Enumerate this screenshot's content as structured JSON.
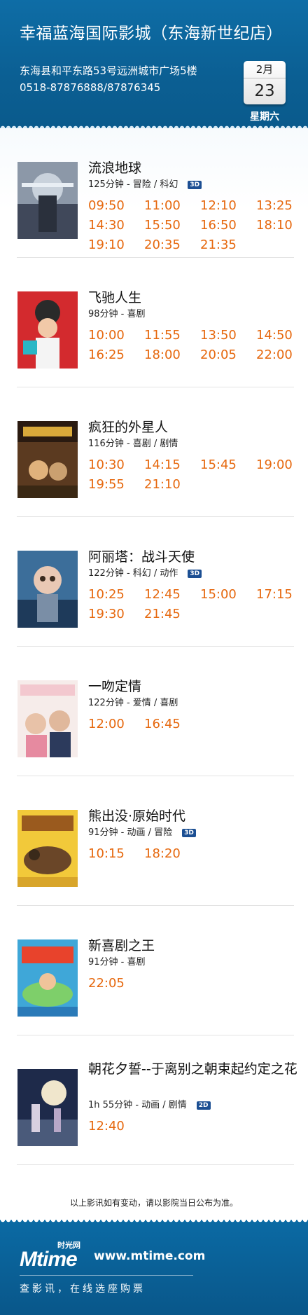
{
  "header": {
    "cinema_name": "幸福蓝海国际影城（东海新世纪店）",
    "address": "东海县和平东路53号远洲城市广场5楼",
    "phone": "0518-87876888/87876345",
    "date_month": "2月",
    "date_day": "23",
    "weekday": "星期六"
  },
  "movies": [
    {
      "title": "流浪地球",
      "info": "125分钟 - 冒险 / 科幻",
      "format": "3D",
      "times": [
        "09:50",
        "11:00",
        "12:10",
        "13:25",
        "14:30",
        "15:50",
        "16:50",
        "18:10",
        "19:10",
        "20:35",
        "21:35"
      ]
    },
    {
      "title": "飞驰人生",
      "info": "98分钟 - 喜剧",
      "format": "",
      "times": [
        "10:00",
        "11:55",
        "13:50",
        "14:50",
        "16:25",
        "18:00",
        "20:05",
        "22:00"
      ]
    },
    {
      "title": "疯狂的外星人",
      "info": "116分钟 - 喜剧 / 剧情",
      "format": "",
      "times": [
        "10:30",
        "14:15",
        "15:45",
        "19:00",
        "19:55",
        "21:10"
      ]
    },
    {
      "title": "阿丽塔：战斗天使",
      "info": "122分钟 - 科幻 / 动作",
      "format": "3D",
      "times": [
        "10:25",
        "12:45",
        "15:00",
        "17:15",
        "19:30",
        "21:45"
      ]
    },
    {
      "title": "一吻定情",
      "info": "122分钟 - 爱情 / 喜剧",
      "format": "",
      "times": [
        "12:00",
        "16:45"
      ]
    },
    {
      "title": "熊出没·原始时代",
      "info": "91分钟 - 动画 / 冒险",
      "format": "3D",
      "times": [
        "10:15",
        "18:20"
      ]
    },
    {
      "title": "新喜剧之王",
      "info": "91分钟 - 喜剧",
      "format": "",
      "times": [
        "22:05"
      ]
    },
    {
      "title": "朝花夕誓--于离别之朝束起约定之花",
      "info": "1h 55分钟 - 动画 / 剧情",
      "format": "2D",
      "times": [
        "12:40"
      ]
    }
  ],
  "notice": "以上影讯如有变动，请以影院当日公布为准。",
  "footer": {
    "logo_sub": "时光网",
    "logo_word": "Mtime",
    "site": "www.mtime.com",
    "slogan": "查影讯，在线选座购票"
  }
}
